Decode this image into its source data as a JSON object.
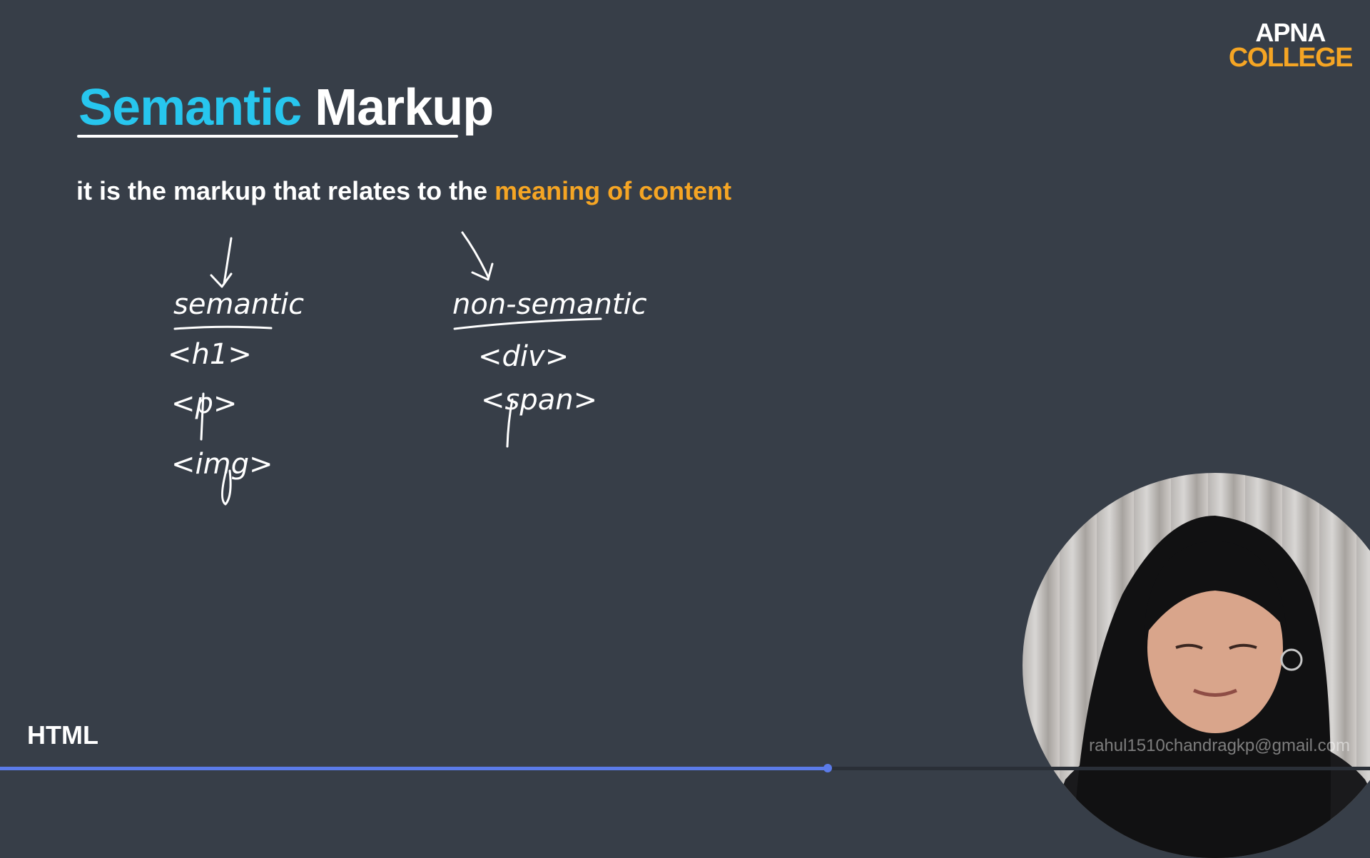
{
  "logo": {
    "line1": "APNA",
    "line2": "COLLEGE"
  },
  "title": {
    "accent": "Semantic",
    "rest": "Markup"
  },
  "subtitle": {
    "text": "it is the markup that relates to the ",
    "highlight": "meaning of content"
  },
  "handwriting": {
    "semantic": {
      "heading": "semantic",
      "tags": [
        "<h1>",
        "<p>",
        "<img>"
      ]
    },
    "non_semantic": {
      "heading": "non-semantic",
      "tags": [
        "<div>",
        "<span>"
      ]
    }
  },
  "footer": {
    "course": "HTML"
  },
  "watermark": {
    "email": "rahul1510chandragkp@gmail.com"
  },
  "video": {
    "progress_fraction": 0.604
  },
  "colors": {
    "background": "#373e48",
    "accent": "#27c6ee",
    "highlight": "#f5a524",
    "progress": "#5b7be9"
  }
}
